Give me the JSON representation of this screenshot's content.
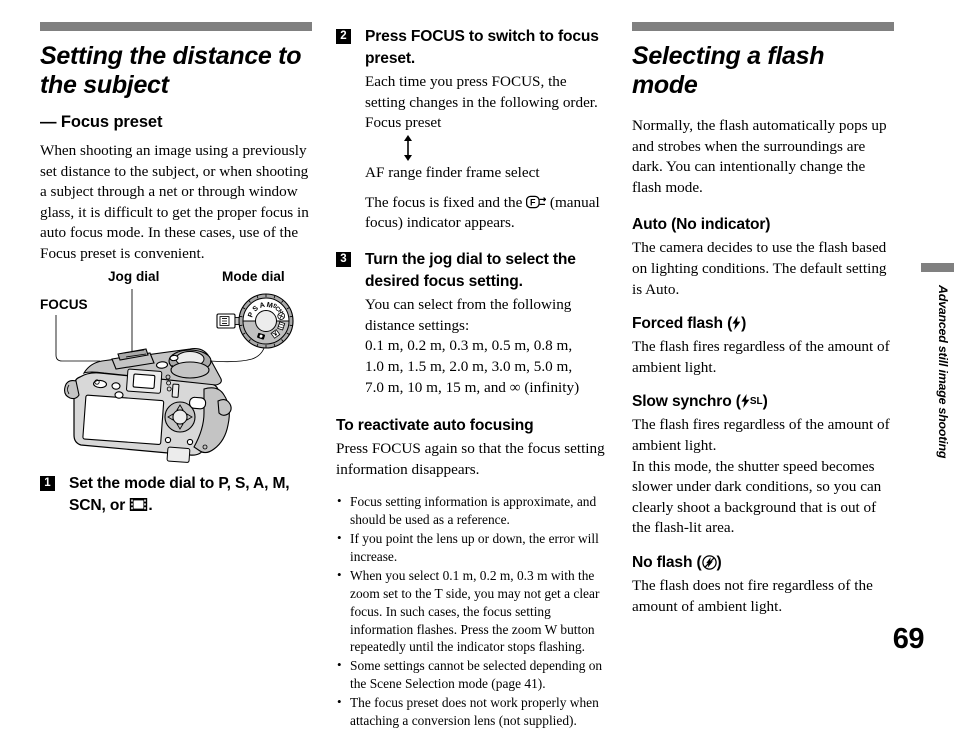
{
  "page": {
    "number": "69",
    "side_tab": "Advanced still image shooting"
  },
  "left_column": {
    "title": "Setting the distance to the subject",
    "subtitle": "— Focus preset",
    "intro": "When shooting an image using a previously set distance to the subject, or when shooting a subject through a net or through window glass, it is difficult to get the proper focus in auto focus mode. In these cases, use of the Focus preset is convenient.",
    "figure": {
      "label_jog_dial": "Jog dial",
      "label_mode_dial": "Mode dial",
      "label_focus": "FOCUS",
      "dial_positions": [
        "P",
        "S",
        "A",
        "M",
        "SCN"
      ]
    },
    "step1": {
      "number": "1",
      "head_before_icon": "Set the mode dial to P, S, A, M, SCN, or ",
      "head_after_icon": "."
    }
  },
  "mid_column": {
    "step2": {
      "number": "2",
      "head": "Press FOCUS to switch to focus preset.",
      "body_1": "Each time you press FOCUS, the setting changes in the following order.",
      "flow_item_1": "Focus preset",
      "flow_item_2": "AF range finder frame select",
      "body_2_before_icon": "The focus is fixed and the ",
      "body_2_after_icon": " (manual focus) indicator appears."
    },
    "step3": {
      "number": "3",
      "head": "Turn the jog dial to select the desired focus setting.",
      "body": "You can select from the following distance settings:",
      "distances_line_1": "0.1 m, 0.2 m, 0.3 m, 0.5 m, 0.8 m,",
      "distances_line_2": "1.0 m, 1.5 m, 2.0 m, 3.0 m, 5.0 m,",
      "distances_line_3": "7.0 m, 10 m, 15 m, and ∞ (infinity)"
    },
    "reactivate": {
      "head": "To reactivate auto focusing",
      "body": "Press FOCUS again so that the focus setting information disappears."
    },
    "notes": [
      "Focus setting information is approximate, and should be used as a reference.",
      "If you point the lens up or down, the error will increase.",
      "When you select 0.1 m, 0.2 m, 0.3 m with the zoom set to the T side, you may not get a clear focus. In such cases, the focus setting information flashes. Press the zoom W button repeatedly until the indicator stops flashing.",
      "Some settings cannot be selected depending on the Scene Selection mode (page 41).",
      "The focus preset does not work properly when attaching a conversion lens (not supplied)."
    ]
  },
  "right_column": {
    "title": "Selecting a flash mode",
    "intro": "Normally, the flash automatically pops up and strobes when the surroundings are dark. You can intentionally change the flash mode.",
    "modes": [
      {
        "head": "Auto (No indicator)",
        "body": "The camera decides to use the flash based on lighting conditions. The default setting is Auto."
      },
      {
        "head_prefix": "Forced flash (",
        "head_suffix": ")",
        "body": "The flash fires regardless of the amount of ambient light."
      },
      {
        "head_prefix": "Slow synchro (",
        "head_sl": "SL",
        "head_suffix": ")",
        "body_1": "The flash fires regardless of the amount of ambient light.",
        "body_2": "In this mode, the shutter speed becomes slower under dark conditions, so you can clearly shoot a background that is out of the flash-lit area."
      },
      {
        "head_prefix": "No flash (",
        "head_suffix": ")",
        "body": "The flash does not fire regardless of the amount of ambient light."
      }
    ]
  },
  "colors": {
    "header_bar": "#808080",
    "text": "#000000",
    "background": "#ffffff"
  }
}
